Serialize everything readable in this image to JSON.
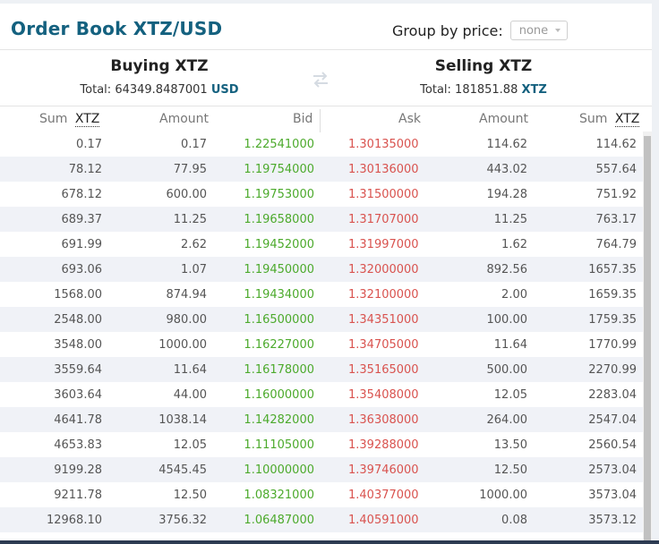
{
  "header": {
    "title": "Order Book XTZ/USD",
    "group_label": "Group by price:",
    "group_value": "none"
  },
  "buying": {
    "title": "Buying XTZ",
    "total_label": "Total:",
    "total_value": "64349.8487001",
    "total_unit": "USD"
  },
  "selling": {
    "title": "Selling XTZ",
    "total_label": "Total:",
    "total_value": "181851.88",
    "total_unit": "XTZ"
  },
  "columns": {
    "sum": "Sum",
    "sum_unit": "XTZ",
    "amount": "Amount",
    "bid": "Bid",
    "ask": "Ask",
    "amount2": "Amount",
    "sum2": "Sum",
    "sum2_unit": "XTZ"
  },
  "colors": {
    "title": "#14617f",
    "bid": "#4caa2c",
    "ask": "#d9534f"
  },
  "rows": [
    [
      "0.17",
      "0.17",
      "1.22541000",
      "1.30135000",
      "114.62",
      "114.62"
    ],
    [
      "78.12",
      "77.95",
      "1.19754000",
      "1.30136000",
      "443.02",
      "557.64"
    ],
    [
      "678.12",
      "600.00",
      "1.19753000",
      "1.31500000",
      "194.28",
      "751.92"
    ],
    [
      "689.37",
      "11.25",
      "1.19658000",
      "1.31707000",
      "11.25",
      "763.17"
    ],
    [
      "691.99",
      "2.62",
      "1.19452000",
      "1.31997000",
      "1.62",
      "764.79"
    ],
    [
      "693.06",
      "1.07",
      "1.19450000",
      "1.32000000",
      "892.56",
      "1657.35"
    ],
    [
      "1568.00",
      "874.94",
      "1.19434000",
      "1.32100000",
      "2.00",
      "1659.35"
    ],
    [
      "2548.00",
      "980.00",
      "1.16500000",
      "1.34351000",
      "100.00",
      "1759.35"
    ],
    [
      "3548.00",
      "1000.00",
      "1.16227000",
      "1.34705000",
      "11.64",
      "1770.99"
    ],
    [
      "3559.64",
      "11.64",
      "1.16178000",
      "1.35165000",
      "500.00",
      "2270.99"
    ],
    [
      "3603.64",
      "44.00",
      "1.16000000",
      "1.35408000",
      "12.05",
      "2283.04"
    ],
    [
      "4641.78",
      "1038.14",
      "1.14282000",
      "1.36308000",
      "264.00",
      "2547.04"
    ],
    [
      "4653.83",
      "12.05",
      "1.11105000",
      "1.39288000",
      "13.50",
      "2560.54"
    ],
    [
      "9199.28",
      "4545.45",
      "1.10000000",
      "1.39746000",
      "12.50",
      "2573.04"
    ],
    [
      "9211.78",
      "12.50",
      "1.08321000",
      "1.40377000",
      "1000.00",
      "3573.04"
    ],
    [
      "12968.10",
      "3756.32",
      "1.06487000",
      "1.40591000",
      "0.08",
      "3573.12"
    ]
  ]
}
